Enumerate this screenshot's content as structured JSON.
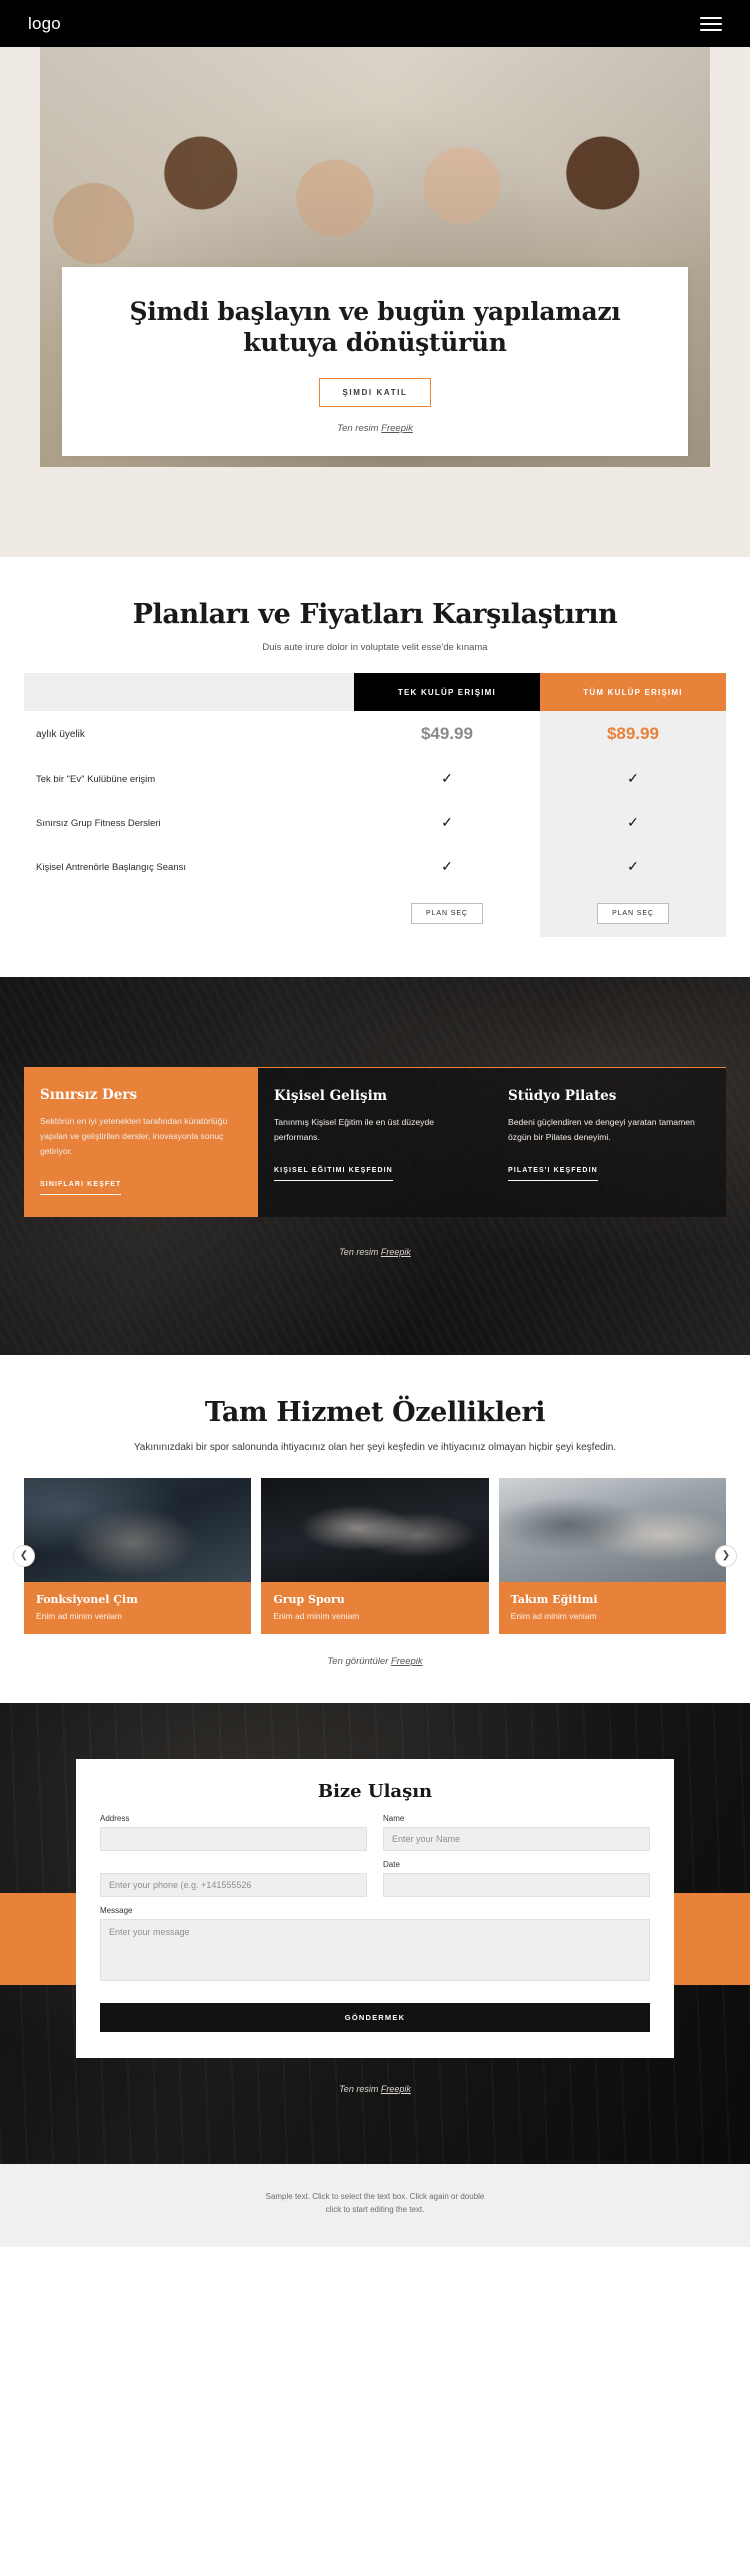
{
  "header": {
    "logo": "logo",
    "menu_icon": "hamburger-menu-icon"
  },
  "hero": {
    "title": "Şimdi başlayın ve bugün yapılamazı kutuya dönüştürün",
    "cta": "ŞIMDI KATIL",
    "credit_prefix": "Ten resim ",
    "credit_link": "Freepik"
  },
  "pricing": {
    "title": "Planları ve Fiyatları Karşılaştırın",
    "subtitle": "Duis aute irure dolor in voluptate velit esse'de kınama",
    "columns": [
      "",
      "TEK KULÜP ERIŞIMI",
      "TÜM KULÜP ERIŞIMI"
    ],
    "price_row_label": "aylık üyelik",
    "price_single": "$49.99",
    "price_all": "$89.99",
    "features": [
      {
        "label": "Tek bir \"Ev\" Kulübüne erişim",
        "single": "✓",
        "all": "✓"
      },
      {
        "label": "Sınırsız Grup Fitness Dersleri",
        "single": "✓",
        "all": "✓"
      },
      {
        "label": "Kişisel Antrenörle Başlangıç Seansı",
        "single": "✓",
        "all": "✓"
      }
    ],
    "select_single": "PLAN SEÇ",
    "select_all": "PLAN SEÇ"
  },
  "features_dark": {
    "cards": [
      {
        "title": "Sınırsız Ders",
        "body": "Sektörün en iyi yetenekleri tarafından küratörlüğü yapılan ve geliştirilen dersler, inovasyonla sonuç getiriyor.",
        "link": "SINIFLARI KEŞFET"
      },
      {
        "title": "Kişisel Gelişim",
        "body": "Tanınmış Kişisel Eğitim ile en üst düzeyde performans.",
        "link": "KIŞISEL EĞITIMI KEŞFEDIN"
      },
      {
        "title": "Stüdyo Pilates",
        "body": "Bedeni güçlendiren ve dengeyi yaratan tamamen özgün bir Pilates deneyimi.",
        "link": "PILATES'I KEŞFEDIN"
      }
    ],
    "credit_prefix": "Ten resim ",
    "credit_link": "Freepik"
  },
  "gallery": {
    "title": "Tam Hizmet Özellikleri",
    "subtitle": "Yakınınızdaki bir spor salonunda ihtiyacınız olan her şeyi keşfedin ve ihtiyacınız olmayan hiçbir şeyi keşfedin.",
    "prev_icon": "chevron-left-icon",
    "next_icon": "chevron-right-icon",
    "items": [
      {
        "title": "Fonksiyonel Çim",
        "caption": "Enim ad minim veniam"
      },
      {
        "title": "Grup Sporu",
        "caption": "Enim ad minim veniam"
      },
      {
        "title": "Takım Eğitimi",
        "caption": "Enim ad minim veniam"
      }
    ],
    "credit_prefix": "Ten görüntüler ",
    "credit_link": "Freepik"
  },
  "contact": {
    "title": "Bize Ulaşın",
    "fields": {
      "address_label": "Address",
      "address_value": "",
      "address_placeholder": "",
      "name_label": "Name",
      "name_placeholder": "Enter your Name",
      "phone_placeholder": "Enter your phone (e.g. +141555526",
      "date_label": "Date",
      "date_placeholder": "",
      "message_label": "Message",
      "message_placeholder": "Enter your message"
    },
    "submit": "GÖNDERMEK",
    "credit_prefix": "Ten resim ",
    "credit_link": "Freepik"
  },
  "footer": {
    "line1": "Sample text. Click to select the text box. Click again or double",
    "line2": "click to start editing the text."
  },
  "colors": {
    "accent": "#e8813a",
    "dark": "#000000",
    "muted_price": "#8b8b8b",
    "field_bg": "#efefef"
  }
}
